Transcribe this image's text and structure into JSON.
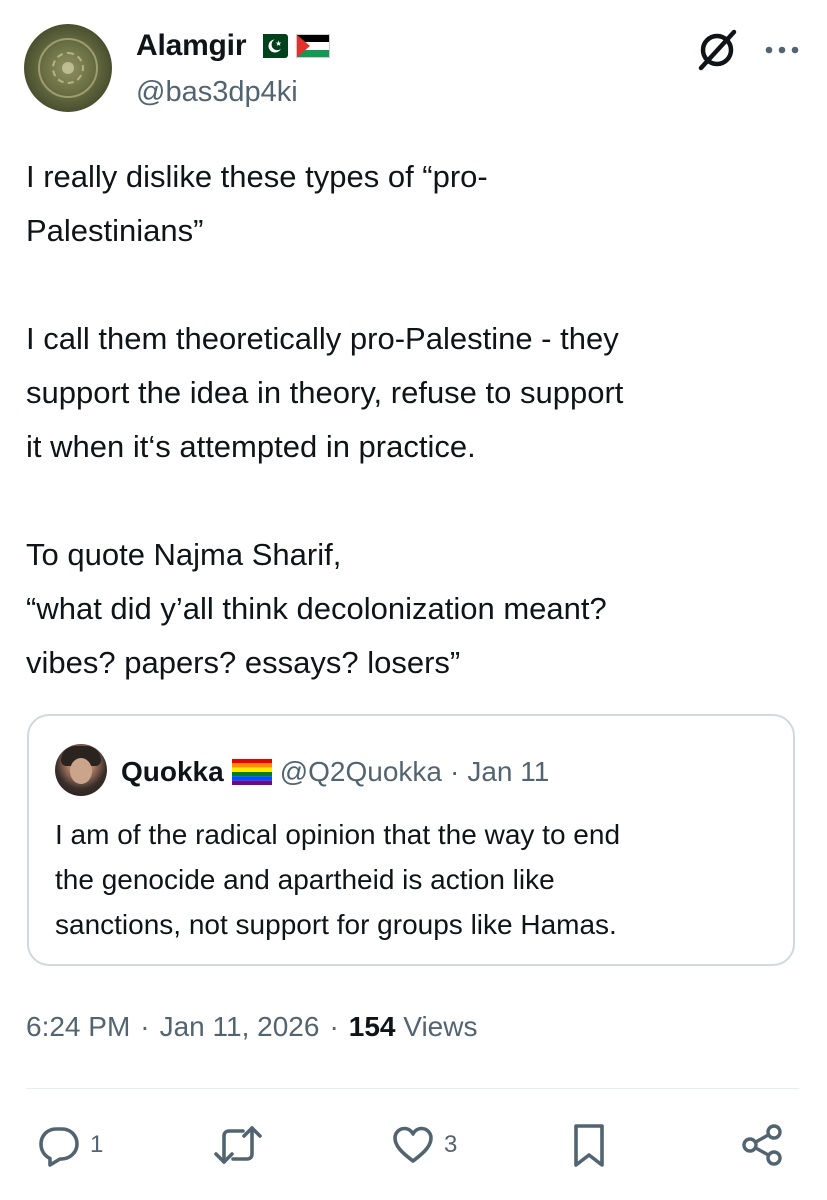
{
  "author": {
    "display_name": "Alamgir",
    "handle": "@bas3dp4ki",
    "flags": [
      "pakistan-flag",
      "palestine-flag"
    ]
  },
  "toolbar": {
    "grok_icon": "grok-icon",
    "more_icon": "more-dots-icon"
  },
  "tweet": {
    "paragraphs": [
      [
        "I really dislike these types of “pro-",
        "Palestinians”"
      ],
      [
        "I call them theoretically pro-Palestine - they",
        "support the idea in theory, refuse to support",
        "it when it‘s attempted in practice."
      ],
      [
        "To quote Najma Sharif,",
        "“what did y’all think decolonization meant?",
        "vibes? papers? essays? losers”"
      ]
    ]
  },
  "quote": {
    "display_name": "Quokka",
    "name_flag": "rainbow-flag",
    "handle": "@Q2Quokka",
    "separator": "·",
    "date": "Jan 11",
    "text_lines": [
      "I am of the radical opinion that the way to end",
      "the genocide and apartheid is action like",
      "sanctions, not support for groups like Hamas."
    ]
  },
  "meta": {
    "time": "6:24 PM",
    "sep1": "·",
    "date": "Jan 11, 2026",
    "sep2": "·",
    "views_count": "154",
    "views_label": "Views"
  },
  "actions": {
    "reply_count": "1",
    "retweet_count": "",
    "like_count": "3"
  },
  "colors": {
    "text": "#0f1419",
    "secondary": "#536471",
    "border": "#cfd9de"
  }
}
